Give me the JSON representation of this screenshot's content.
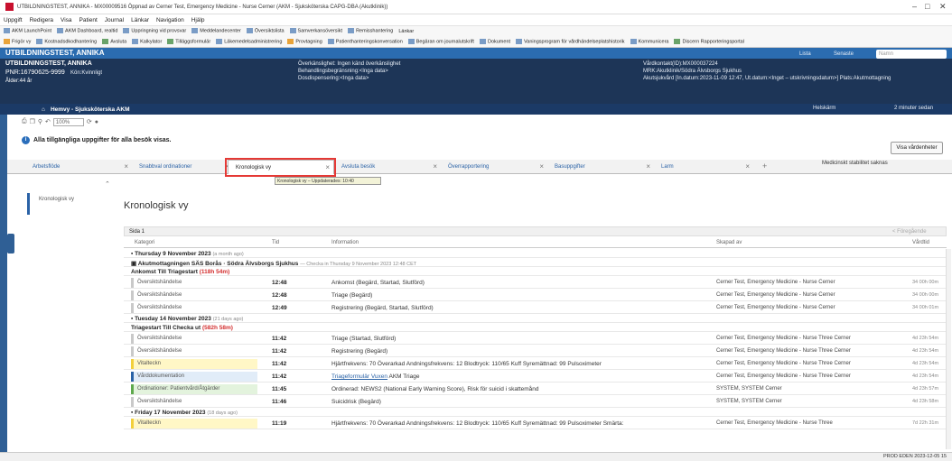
{
  "window": {
    "title": "UTBILDNINGSTEST, ANNIKA - MX00009516 Öppnad av Cerner Test, Emergency Medicine - Nurse Cerner (AKM - Sjuksköterska CAPG-DBA (Akutklinik))",
    "min": "–",
    "max": "□",
    "close": "✕"
  },
  "menu": [
    "Uppgift",
    "Redigera",
    "Visa",
    "Patient",
    "Journal",
    "Länkar",
    "Navigation",
    "Hjälp"
  ],
  "toolbar1": [
    "AKM LaunchPoint",
    "AKM Dashboard, realtid",
    "Uppringning vid provsvar",
    "Meddelandecenter",
    "Översiktslista",
    "Samverkansöversikt",
    "Remisshantering",
    "Länkar"
  ],
  "toolbar2": [
    "Frigör vy",
    "Kostnadsdkodhantering",
    "Avsluta",
    "Kalkylator",
    "Tilläggsformulär",
    "Läkemedelsadministrering",
    "Provtagning",
    "Patienthanteringskonversation",
    "Begäran om journalutskrift",
    "Dokument",
    "Vaningsprogram för vårdhändelseplatshistorik",
    "Kommunicera",
    "Discern Rapporteringsportal"
  ],
  "banner": {
    "header": "UTBILDNINGSTEST, ANNIKA",
    "name": "UTBILDNINGSTEST, ANNIKA",
    "pnr": "PNR:16790625-9999",
    "gender": "Kön:Kvinnligt",
    "age": "Ålder:44 år",
    "allergy": "Överkänslighet: Ingen känd överkänslighet",
    "limit": "Behandlingsbegränsning:<Inga data>",
    "dosing": "Dosdispensering:<Inga data>",
    "vk": "Vårdkontakt(ID):MX000037224",
    "mrk": "MRK:Akutklinik/Södra Älvsborgs Sjukhus",
    "visit": "Akutsjukvård [In.datum:2023-11-09 12:47, Ut.datum:<Inget – utskrivningsdatum>] Plats:Akutmottagning",
    "list": "Lista",
    "senaste": "Senaste",
    "search": "Namn",
    "hembtn": "Helskärm",
    "refresh": "2 minuter sedan"
  },
  "nav": {
    "home": "Hemvy - Sjuksköterska AKM"
  },
  "zoom": "100%",
  "info": "Alla tillgängliga uppgifter för alla besök visas.",
  "visa_btn": "Visa vårdenheter",
  "tabs": [
    "Arbetsflöde",
    "Snabbval ordinationer",
    "Kronologisk vy",
    "Avsluta besök",
    "Överrapportering",
    "Basuppgifter",
    "Larm"
  ],
  "tooltip": "Kronologisk vy – Uppdaterades: 10:40",
  "rtoolbar": "Medicinskt stabilitet saknas",
  "left": {
    "item": "Kronologisk vy"
  },
  "view": {
    "title": "Kronologisk vy",
    "side": "Sida 1",
    "prev": "< Föregående",
    "next": "Nästa >"
  },
  "cols": {
    "cat": "Kategori",
    "time": "Tid",
    "info": "Information",
    "by": "Skapad av",
    "vt": "Vårdtid"
  },
  "rows": [
    {
      "type": "day",
      "text": "Thursday 9 November 2023",
      "sub": "(a month ago)"
    },
    {
      "type": "loc",
      "text": "Akutmottagningen SÄS Borås · Södra Älvsborgs Sjukhus",
      "sub": "— Checka in Thursday 9 November 2023 12:48 CET"
    },
    {
      "type": "seg",
      "text": "Ankomst Till Triagestart",
      "red": "(118h 54m)"
    },
    {
      "type": "ev",
      "cat": "Översiktshändelse",
      "time": "12:48",
      "info": "Ankomst (Begärd, Startad, Slutförd)",
      "by": "Cerner Test, Emergency Medicine - Nurse Cerner",
      "vt": "34 00h 00m"
    },
    {
      "type": "ev",
      "cat": "Översiktshändelse",
      "time": "12:48",
      "info": "Triage (Begärd)",
      "by": "Cerner Test, Emergency Medicine - Nurse Cerner",
      "vt": "34 00h 00m"
    },
    {
      "type": "ev",
      "cat": "Översiktshändelse",
      "time": "12:49",
      "info": "Registrering (Begärd, Startad, Slutförd)",
      "by": "Cerner Test, Emergency Medicine - Nurse Cerner",
      "vt": "34 00h 01m"
    },
    {
      "type": "day",
      "text": "Tuesday 14 November 2023",
      "sub": "(21 days ago)"
    },
    {
      "type": "seg",
      "text": "Triagestart Till Checka ut",
      "red": "(582h 58m)"
    },
    {
      "type": "ev",
      "cat": "Översiktshändelse",
      "time": "11:42",
      "info": "Triage (Startad, Slutförd)",
      "by": "Cerner Test, Emergency Medicine - Nurse Three Cerner",
      "vt": "4d 23h 54m"
    },
    {
      "type": "ev",
      "cat": "Översiktshändelse",
      "time": "11:42",
      "info": "Registrering (Begärd)",
      "by": "Cerner Test, Emergency Medicine - Nurse Three Cerner",
      "vt": "4d 23h 54m"
    },
    {
      "type": "ev",
      "cls": "yel",
      "cat": "Vitalteckn",
      "time": "11:42",
      "info": "Hjärtfrekvens: 70 Överarkad   Andningsfrekvens: 12   Blodtryck: 110/65 Kuff   Syremättnad: 99 Pulsoximeter",
      "by": "Cerner Test, Emergency Medicine - Nurse Three Cerner",
      "vt": "4d 23h 54m"
    },
    {
      "type": "ev",
      "cls": "blue",
      "cat": "Vårddokumentation",
      "time": "11:42",
      "info": "AKM Triage",
      "link": "Triageformulär Vuxen",
      "by": "Cerner Test, Emergency Medicine - Nurse Three Cerner",
      "vt": "4d 23h 54m"
    },
    {
      "type": "ev",
      "cls": "grn",
      "cat": "Ordinationer: Patientvård/Åtgärder",
      "time": "11:45",
      "info": "Ordinerad: NEWS2 (National Early Warning Score), Risk för suicid i skattemånd",
      "by": "SYSTEM, SYSTEM Cerner",
      "vt": "4d 23h 57m"
    },
    {
      "type": "ev",
      "cat": "Översiktshändelse",
      "time": "11:46",
      "info": "Suicidrisk (Begärd)",
      "by": "SYSTEM, SYSTEM Cerner",
      "vt": "4d 23h 58m"
    },
    {
      "type": "day",
      "text": "Friday 17 November 2023",
      "sub": "(18 days ago)"
    },
    {
      "type": "ev",
      "cls": "yel",
      "cat": "Vitalteckn",
      "time": "11:19",
      "info": "Hjärtfrekvens: 70 Överarkad   Andningsfrekvens: 12   Blodtryck: 110/65 Kuff   Syremättnad: 99 Pulsoximeter   Smärta:",
      "by": "Cerner Test, Emergency Medicine - Nurse Three",
      "vt": "7d 22h 31m"
    }
  ],
  "status": "PROD  EDEN  2023-12-05  15"
}
